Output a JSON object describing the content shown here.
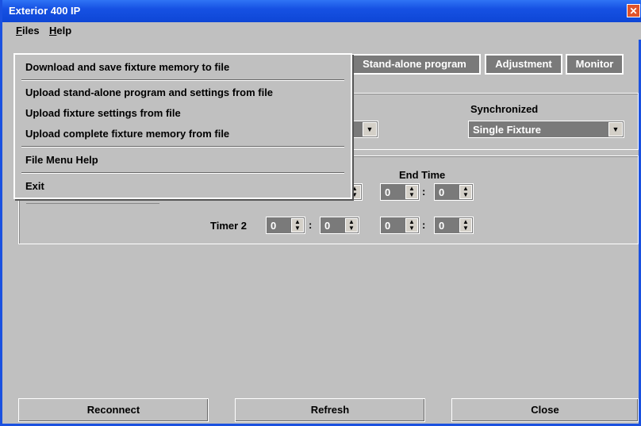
{
  "window": {
    "title": "Exterior 400 IP",
    "close_glyph": "✕"
  },
  "menubar": {
    "files": {
      "first": "F",
      "rest": "iles"
    },
    "help": {
      "first": "H",
      "rest": "elp"
    }
  },
  "tabs": [
    "Stand-alone program",
    "Adjustment",
    "Monitor"
  ],
  "sync": {
    "label": "Synchronized",
    "value": "Single Fixture"
  },
  "timers": {
    "end_time_label": "End Time",
    "timer2_label": "Timer 2",
    "value": "0"
  },
  "file_menu": {
    "items": [
      "Download and save fixture memory to file",
      "Upload stand-alone program and settings from file",
      "Upload fixture settings from file",
      "Upload complete fixture memory from file",
      "File Menu Help",
      "Exit"
    ]
  },
  "buttons": {
    "reconnect": "Reconnect",
    "refresh": "Refresh",
    "close": "Close"
  },
  "icons": {
    "close": "close-icon",
    "dropdown": "chevron-down-icon",
    "spin": "spin-arrows-icon"
  }
}
